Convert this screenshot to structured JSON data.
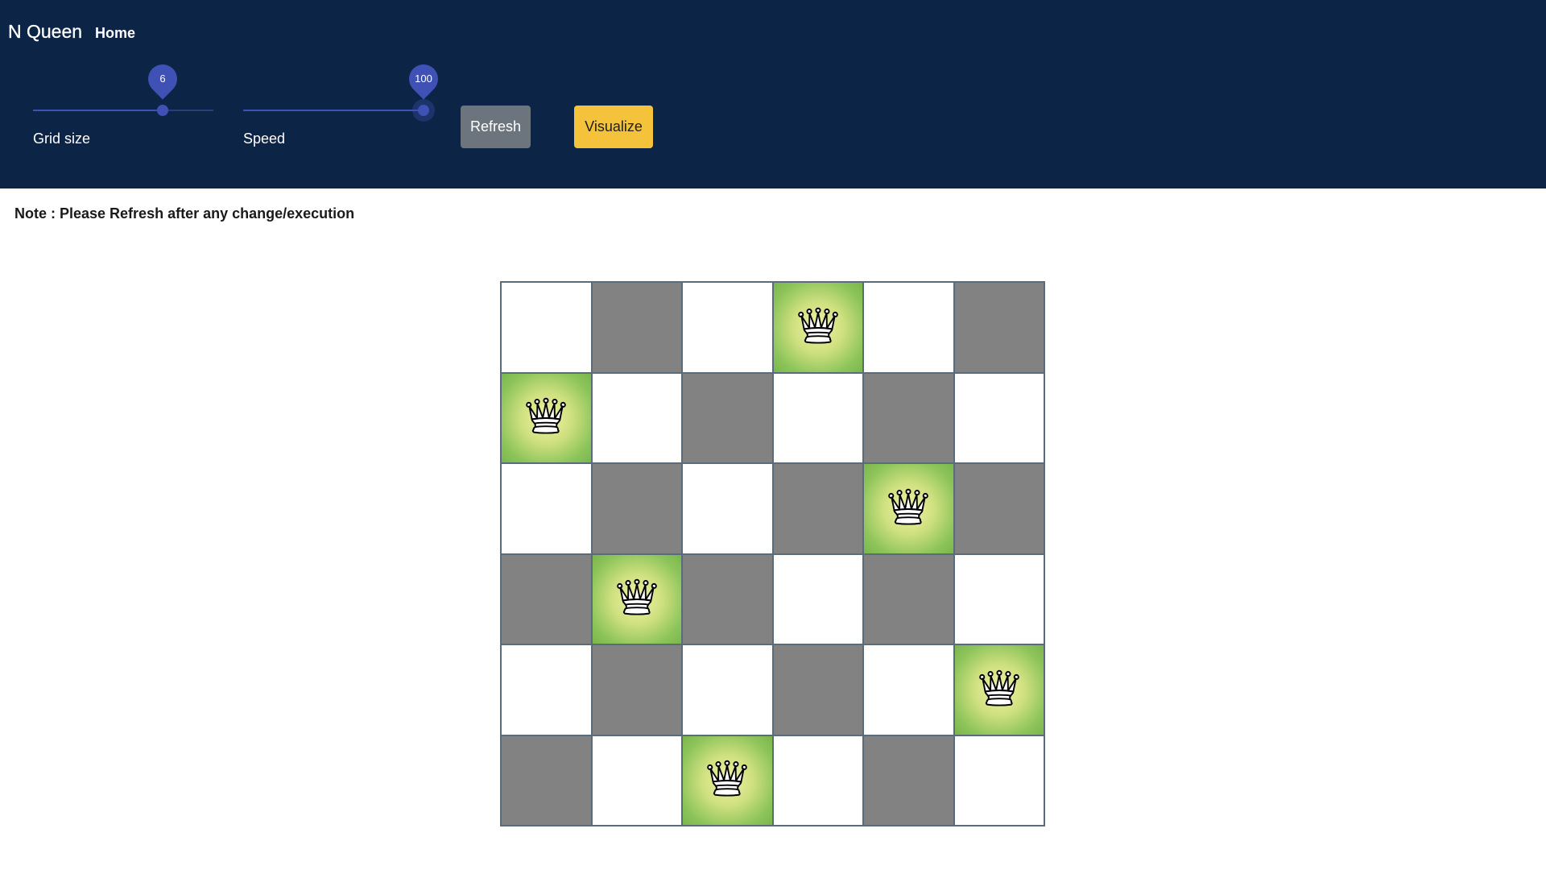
{
  "header": {
    "brand": "N Queen",
    "nav": {
      "home_label": "Home"
    }
  },
  "controls": {
    "grid_size": {
      "label": "Grid size",
      "value": 6,
      "min": 4,
      "max": 7,
      "fill_fraction": 0.72
    },
    "speed": {
      "label": "Speed",
      "value": 100,
      "min": 0,
      "max": 100,
      "fill_fraction": 1.0
    },
    "refresh_label": "Refresh",
    "visualize_label": "Visualize"
  },
  "note": "Note : Please Refresh after any change/execution",
  "board": {
    "size": 6,
    "queens_row_to_col": [
      3,
      0,
      4,
      1,
      5,
      2
    ],
    "queen_icon": "chess-queen-icon"
  },
  "colors": {
    "header_bg": "#0c2446",
    "slider": "#3f51b5",
    "refresh_bg": "#6c757d",
    "visualize_bg": "#f5c33b",
    "dark_square": "#828282",
    "light_square": "#ffffff",
    "queen_square": "#8cc45a"
  }
}
